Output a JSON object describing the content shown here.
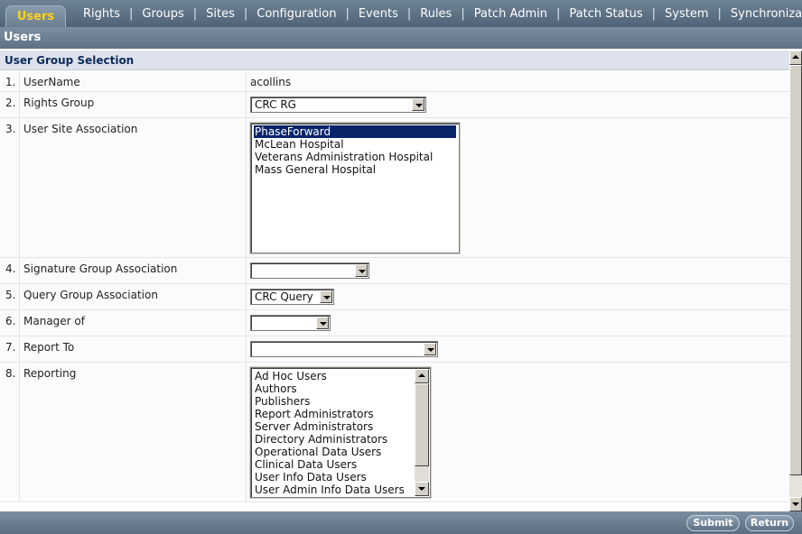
{
  "nav": {
    "active": "Users",
    "items": [
      "Rights",
      "Groups",
      "Sites",
      "Configuration",
      "Events",
      "Rules",
      "Patch Admin",
      "Patch Status",
      "System",
      "Synchronization"
    ],
    "separator": "|"
  },
  "page": {
    "title": "Users"
  },
  "section": {
    "title": "User Group Selection"
  },
  "form": {
    "rows": [
      {
        "num": "1.",
        "label": "UserName",
        "value": "acollins"
      },
      {
        "num": "2.",
        "label": "Rights Group",
        "selected": "CRC RG"
      },
      {
        "num": "3.",
        "label": "User Site Association",
        "options": [
          "PhaseForward",
          "McLean Hospital",
          "Veterans Administration Hospital",
          "Mass General Hospital"
        ],
        "selected": "PhaseForward"
      },
      {
        "num": "4.",
        "label": "Signature Group Association",
        "selected": ""
      },
      {
        "num": "5.",
        "label": "Query Group Association",
        "selected": "CRC Query"
      },
      {
        "num": "6.",
        "label": "Manager of",
        "selected": ""
      },
      {
        "num": "7.",
        "label": "Report To",
        "selected": ""
      },
      {
        "num": "8.",
        "label": "Reporting",
        "options": [
          "Ad Hoc Users",
          "Authors",
          "Publishers",
          "Report Administrators",
          "Server Administrators",
          "Directory Administrators",
          "Operational Data Users",
          "Clinical Data Users",
          "User Info Data Users",
          "User Admin Info Data Users"
        ]
      }
    ]
  },
  "footer": {
    "submit": "Submit",
    "return": "Return"
  },
  "colors": {
    "active_tab_text": "#ffd21a",
    "nav_bar": "#5b6d80",
    "section_header_bg": "#dde2ec",
    "selection": "#0a246a"
  }
}
